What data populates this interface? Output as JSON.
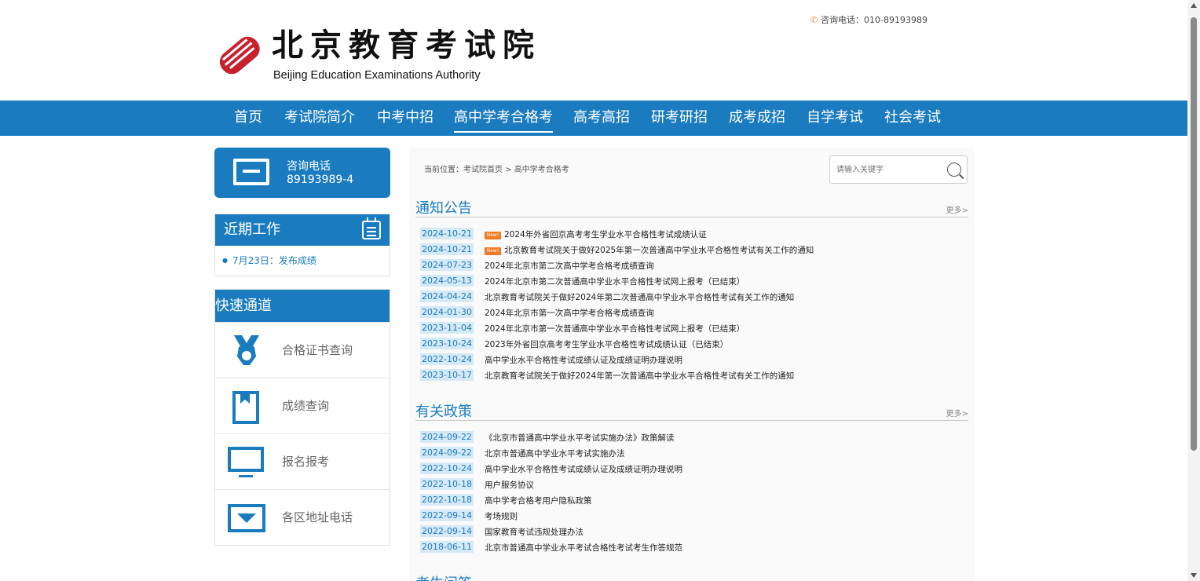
{
  "header": {
    "logo_cn": "北京教育考试院",
    "logo_en": "Beijing Education Examinations Authority",
    "hotline": "咨询电话：010-89193989"
  },
  "nav": {
    "items": [
      "首页",
      "考试院简介",
      "中考中招",
      "高中学考合格考",
      "高考高招",
      "研考研招",
      "成考成招",
      "自学考试",
      "社会考试"
    ],
    "active": "高中学考合格考"
  },
  "sidebar": {
    "hotline_label": "咨询电话",
    "hotline_number": "89193989-4",
    "recent_title": "近期工作",
    "recent_items": [
      "7月23日：发布成绩"
    ],
    "quick_title": "快速通道",
    "quick_items": [
      "合格证书查询",
      "成绩查询",
      "报名报考",
      "各区地址电话"
    ]
  },
  "main": {
    "breadcrumb": "当前位置：考试院首页 > 高中学考合格考",
    "search_placeholder": "请输入关键字",
    "badge_label": "New!",
    "more_label": "更多>",
    "sections": [
      {
        "title": "通知公告",
        "items": [
          {
            "date": "2024-10-21",
            "title": "2024年外省回京高考考生学业水平合格性考试成绩认证",
            "new": true
          },
          {
            "date": "2024-10-21",
            "title": "北京教育考试院关于做好2025年第一次普通高中学业水平合格性考试有关工作的通知",
            "new": true
          },
          {
            "date": "2024-07-23",
            "title": "2024年北京市第二次高中学考合格考成绩查询",
            "new": false
          },
          {
            "date": "2024-05-13",
            "title": "2024年北京市第二次普通高中学业水平合格性考试网上报考（已结束）",
            "new": false
          },
          {
            "date": "2024-04-24",
            "title": "北京教育考试院关于做好2024年第二次普通高中学业水平合格性考试有关工作的通知",
            "new": false
          },
          {
            "date": "2024-01-30",
            "title": "2024年北京市第一次高中学考合格考成绩查询",
            "new": false
          },
          {
            "date": "2023-11-04",
            "title": "2024年北京市第一次普通高中学业水平合格性考试网上报考（已结束）",
            "new": false
          },
          {
            "date": "2023-10-24",
            "title": "2023年外省回京高考考生学业水平合格性考试成绩认证（已结束）",
            "new": false
          },
          {
            "date": "2022-10-24",
            "title": "高中学业水平合格性考试成绩认证及成绩证明办理说明",
            "new": false
          },
          {
            "date": "2023-10-17",
            "title": "北京教育考试院关于做好2024年第一次普通高中学业水平合格性考试有关工作的通知",
            "new": false
          }
        ]
      },
      {
        "title": "有关政策",
        "items": [
          {
            "date": "2024-09-22",
            "title": "《北京市普通高中学业水平考试实施办法》政策解读",
            "new": false
          },
          {
            "date": "2024-09-22",
            "title": "北京市普通高中学业水平考试实施办法",
            "new": false
          },
          {
            "date": "2022-10-24",
            "title": "高中学业水平合格性考试成绩认证及成绩证明办理说明",
            "new": false
          },
          {
            "date": "2022-10-18",
            "title": "用户服务协议",
            "new": false
          },
          {
            "date": "2022-10-18",
            "title": "高中学考合格考用户隐私政策",
            "new": false
          },
          {
            "date": "2022-09-14",
            "title": "考场规则",
            "new": false
          },
          {
            "date": "2022-09-14",
            "title": "国家教育考试违规处理办法",
            "new": false
          },
          {
            "date": "2018-06-11",
            "title": "北京市普通高中学业水平考试合格性考试考生作答规范",
            "new": false
          }
        ]
      },
      {
        "title": "考生问答",
        "items": []
      }
    ]
  },
  "colors": {
    "primary": "#1a7cbf",
    "logo_red": "#c8202c",
    "new_badge": "#f07b26"
  }
}
